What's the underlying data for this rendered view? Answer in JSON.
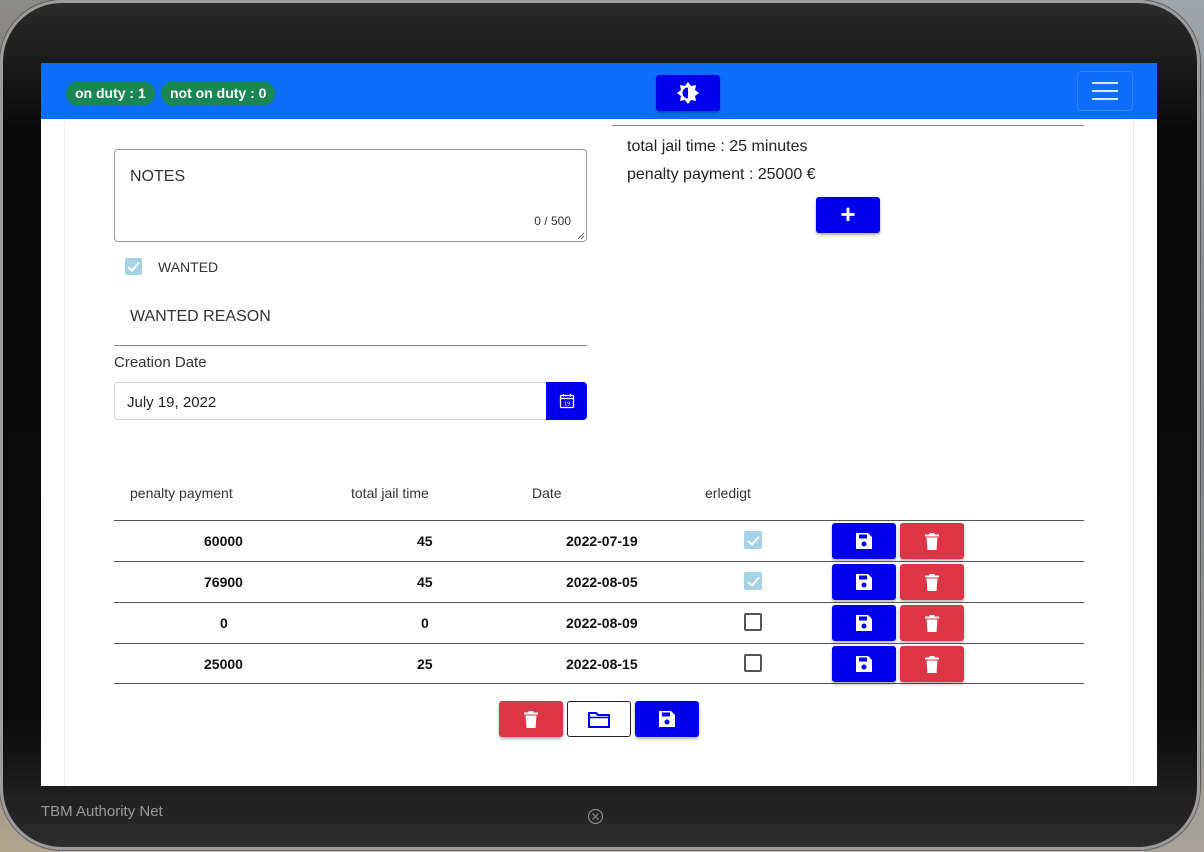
{
  "navbar": {
    "on_duty": "on duty : 1",
    "not_on_duty": "not on duty : 0",
    "theme_icon": "brightness-icon",
    "menu_icon": "hamburger-menu-icon",
    "color": "#0d6efd"
  },
  "form": {
    "notes_label": "NOTES",
    "notes_counter": "0 / 500",
    "wanted_label": "WANTED",
    "wanted_checked": true,
    "wanted_reason_label": "WANTED REASON",
    "creation_date_label": "Creation Date",
    "creation_date_value": "July 19, 2022",
    "calendar_icon": "calendar-icon"
  },
  "summary": {
    "total_jail_time": "total jail time : 25 minutes",
    "penalty_payment": "penalty payment : 25000 €",
    "add_label": "+"
  },
  "table": {
    "headers": [
      "penalty payment",
      "total jail time",
      "Date",
      "erledigt"
    ],
    "rows": [
      {
        "penalty": "60000",
        "jail": "45",
        "date": "2022-07-19",
        "done": true
      },
      {
        "penalty": "76900",
        "jail": "45",
        "date": "2022-08-05",
        "done": true
      },
      {
        "penalty": "0",
        "jail": "0",
        "date": "2022-08-09",
        "done": false
      },
      {
        "penalty": "25000",
        "jail": "25",
        "date": "2022-08-15",
        "done": false
      }
    ]
  },
  "actions": {
    "delete_icon": "trash-icon",
    "open_icon": "folder-icon",
    "save_icon": "floppy-disk-icon"
  },
  "colors": {
    "primary": "#0000ee",
    "danger": "#dc3545",
    "success": "#198754"
  },
  "footer": {
    "brand": "TBM Authority Net",
    "close_icon": "close-circle-icon"
  }
}
